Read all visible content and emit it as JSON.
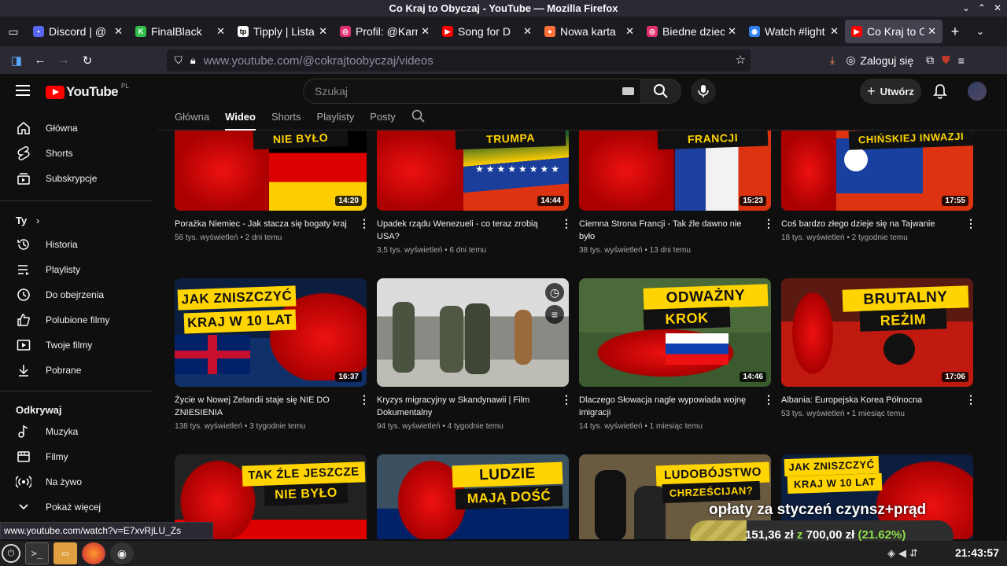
{
  "window": {
    "title": "Co Kraj to Obyczaj - YouTube — Mozilla Firefox"
  },
  "tabs": [
    {
      "label": "Discord | @",
      "favicon_color": "#5865f2",
      "favicon_char": "•",
      "prefix": "•"
    },
    {
      "label": "FinalBlack",
      "favicon_color": "#2fbf4a",
      "favicon_char": "K"
    },
    {
      "label": "Tipply | Lista",
      "favicon_color": "#ffffff",
      "favicon_char": "tp"
    },
    {
      "label": "Profil: @Karn",
      "favicon_color": "#e1306c",
      "favicon_char": "◎"
    },
    {
      "label": "Song for D",
      "favicon_color": "#ff0000",
      "favicon_char": "▶"
    },
    {
      "label": "Nowa karta",
      "favicon_color": "#ff7139",
      "favicon_char": "●"
    },
    {
      "label": "Biedne dziec",
      "favicon_color": "#e1306c",
      "favicon_char": "◎"
    },
    {
      "label": "Watch #light",
      "favicon_color": "#2f80ed",
      "favicon_char": "◉"
    },
    {
      "label": "Co Kraj to Ob",
      "favicon_color": "#ff0000",
      "favicon_char": "▶",
      "active": true
    }
  ],
  "nav": {
    "url_host": "www.youtube.com",
    "url_path": "/@cokrajtoobyczaj/videos",
    "login_label": "Zaloguj się"
  },
  "yt": {
    "logo_text": "YouTube",
    "logo_region": "PL",
    "search_placeholder": "Szukaj",
    "create_label": "Utwórz",
    "channel_tabs": [
      "Główna",
      "Wideo",
      "Shorts",
      "Playlisty",
      "Posty"
    ],
    "active_tab": "Wideo"
  },
  "sidebar": {
    "main": [
      {
        "label": "Główna",
        "icon": "home-icon"
      },
      {
        "label": "Shorts",
        "icon": "shorts-icon"
      },
      {
        "label": "Subskrypcje",
        "icon": "subscriptions-icon"
      }
    ],
    "you_heading": "Ty",
    "you": [
      {
        "label": "Historia",
        "icon": "history-icon"
      },
      {
        "label": "Playlisty",
        "icon": "playlists-icon"
      },
      {
        "label": "Do obejrzenia",
        "icon": "watch-later-icon"
      },
      {
        "label": "Polubione filmy",
        "icon": "like-icon"
      },
      {
        "label": "Twoje filmy",
        "icon": "your-videos-icon"
      },
      {
        "label": "Pobrane",
        "icon": "download-icon"
      }
    ],
    "explore_heading": "Odkrywaj",
    "explore": [
      {
        "label": "Muzyka",
        "icon": "music-icon"
      },
      {
        "label": "Filmy",
        "icon": "film-icon"
      },
      {
        "label": "Na żywo",
        "icon": "live-icon"
      },
      {
        "label": "Pokaż więcej",
        "icon": "chevron-down-icon"
      }
    ]
  },
  "videos": [
    {
      "title": "Porażka Niemiec - Jak stacza się bogaty kraj",
      "meta": "56 tys. wyświetleń • 2 dni temu",
      "duration": "14:20",
      "banner": "NIE BYŁO"
    },
    {
      "title": "Upadek rządu Wenezueli - co teraz zrobią USA?",
      "meta": "3,5 tys. wyświetleń • 6 dni temu",
      "duration": "14:44",
      "banner": "TRUMPA"
    },
    {
      "title": "Ciemna Strona Francji - Tak źle dawno nie było",
      "meta": "38 tys. wyświetleń • 13 dni temu",
      "duration": "15:23",
      "banner": "FRANCJI"
    },
    {
      "title": "Coś bardzo złego dzieje się na Tajwanie",
      "meta": "18 tys. wyświetleń • 2 tygodnie temu",
      "duration": "17:55",
      "banner": "CHIŃSKIEJ INWAZJI"
    },
    {
      "title": "Życie w Nowej Zelandii staje się NIE DO ZNIESIENIA",
      "meta": "138 tys. wyświetleń • 3 tygodnie temu",
      "duration": "16:37",
      "banner": "JAK ZNISZCZYĆ",
      "banner2": "KRAJ W 10 LAT"
    },
    {
      "title": "Kryzys migracyjny w Skandynawii | Film Dokumentalny",
      "meta": "94 tys. wyświetleń • 4 tygodnie temu",
      "duration": "",
      "banner": ""
    },
    {
      "title": "Dlaczego Słowacja nagle wypowiada wojnę imigracji",
      "meta": "14 tys. wyświetleń • 1 miesiąc temu",
      "duration": "14:46",
      "banner": "ODWAŻNY",
      "banner2": "KROK"
    },
    {
      "title": "Albania: Europejska Korea Północna",
      "meta": "53 tys. wyświetleń • 1 miesiąc temu",
      "duration": "17:06",
      "banner": "BRUTALNY",
      "banner2": "REŻIM"
    },
    {
      "title": "",
      "meta": "",
      "duration": "",
      "banner": "TAK ŹLE JESZCZE",
      "banner2": "NIE BYŁO"
    },
    {
      "title": "",
      "meta": "",
      "duration": "",
      "banner": "LUDZIE",
      "banner2": "MAJĄ DOŚĆ"
    },
    {
      "title": "",
      "meta": "",
      "duration": "",
      "banner": "LUDOBÓJSTWO",
      "banner2": "CHRZEŚCIJAN?"
    },
    {
      "title": "",
      "meta": "",
      "duration": "",
      "banner": "JAK ZNISZCZYĆ",
      "banner2": "KRAJ W 10 LAT"
    }
  ],
  "status_url": "www.youtube.com/watch?v=E7xvRjLU_Zs",
  "overlay": {
    "headline": "opłaty za styczeń czynsz+prąd",
    "progress_text_a": "151,36 zł",
    "progress_text_z": "z",
    "progress_text_b": "700,00 zł",
    "progress_pct": "(21.62%)",
    "progress_fraction": 0.2162
  },
  "clock": "21:43:57"
}
